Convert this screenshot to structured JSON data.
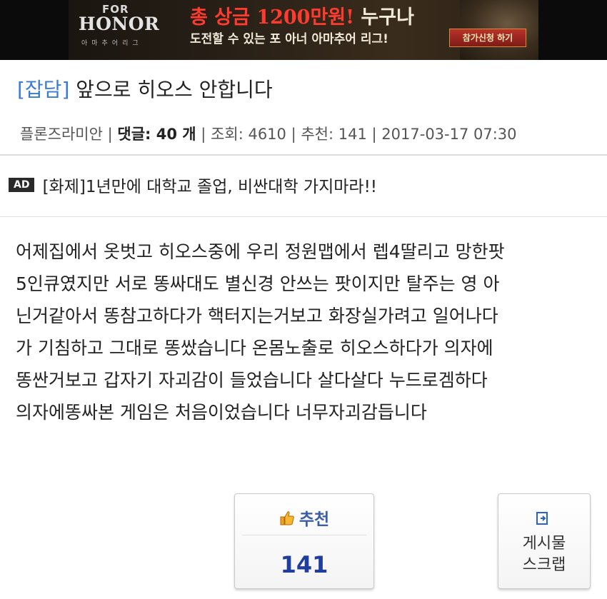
{
  "banner": {
    "brand_for": "FOR",
    "brand_honor": "HONOR",
    "brand_sub": "아마추어리그",
    "headline_red": "총 상금 1200만원!",
    "headline_white": "누구나",
    "subline": "도전할 수 있는 포 아너 아마추어 리그!",
    "button": "참가신청 하기"
  },
  "post": {
    "category": "[잡담]",
    "title": "앞으로 히오스 안합니다",
    "author": "플론즈라미안",
    "comments_label": "댓글:",
    "comments_count": "40",
    "comments_unit": "개",
    "views_label": "조회: 4610",
    "recommend_label": "추천: 141",
    "date": "2017-03-17 07:30"
  },
  "ad": {
    "badge": "AD",
    "text": "[화제]1년만에 대학교 졸업, 비싼대학 가지마라!!"
  },
  "body_lines": [
    "어제집에서 옷벗고 히오스중에 우리 정원맵에서 렙4딸리고 망한팟",
    "5인큐였지만 서로 똥싸대도 별신경 안쓰는 팟이지만 탈주는 영 아",
    "닌거같아서 똥참고하다가 핵터지는거보고 화장실가려고 일어나다",
    "가 기침하고 그대로 똥쌌습니다 온몸노출로 히오스하다가 의자에",
    "똥싼거보고 갑자기 자괴감이 들었습니다 살다살다 누드로겜하다",
    "의자에똥싸본 게임은 처음이었습니다 너무자괴감듭니다"
  ],
  "actions": {
    "recommend_label": "추천",
    "recommend_count": "141",
    "scrap_line1": "게시물",
    "scrap_line2": "스크랩"
  },
  "colors": {
    "category": "#3a7bd5",
    "recommend": "#3a5ea8",
    "count": "#1f3d9e"
  }
}
